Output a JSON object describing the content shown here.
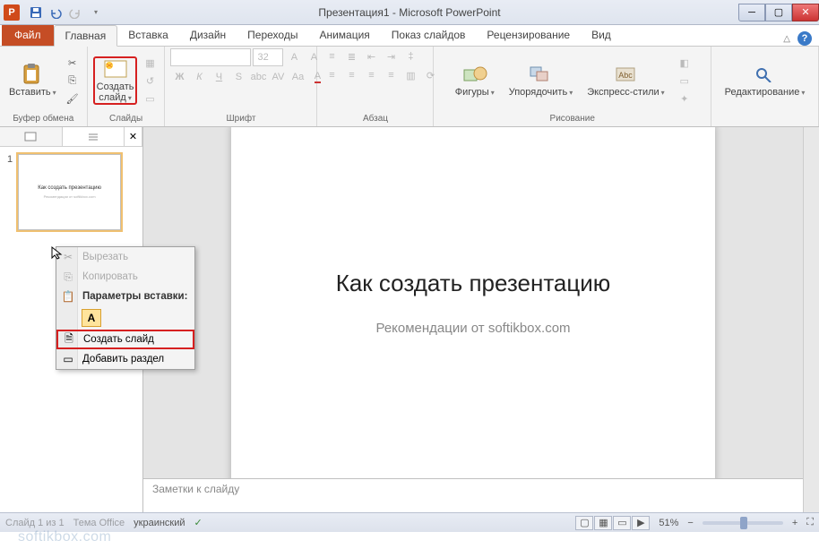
{
  "window": {
    "title": "Презентация1 - Microsoft PowerPoint",
    "app_letter": "P"
  },
  "tabs": {
    "file": "Файл",
    "items": [
      "Главная",
      "Вставка",
      "Дизайн",
      "Переходы",
      "Анимация",
      "Показ слайдов",
      "Рецензирование",
      "Вид"
    ],
    "active_index": 0
  },
  "ribbon": {
    "clipboard": {
      "paste": "Вставить",
      "group": "Буфер обмена"
    },
    "slides": {
      "new_slide": "Создать\nслайд",
      "group": "Слайды"
    },
    "font": {
      "size": "32",
      "group": "Шрифт"
    },
    "paragraph": {
      "group": "Абзац"
    },
    "drawing": {
      "shapes": "Фигуры",
      "arrange": "Упорядочить",
      "styles": "Экспресс-стили",
      "group": "Рисование"
    },
    "editing": {
      "label": "Редактирование"
    }
  },
  "panel": {
    "slide_number": "1",
    "thumb_title": "Как создать презентацию",
    "thumb_sub": "Рекомендации от softikbox.com"
  },
  "context_menu": {
    "cut": "Вырезать",
    "copy": "Копировать",
    "paste_options": "Параметры вставки:",
    "paste_letter": "A",
    "new_slide": "Создать слайд",
    "add_section": "Добавить раздел"
  },
  "slide": {
    "title": "Как создать презентацию",
    "subtitle": "Рекомендации от softikbox.com"
  },
  "notes": {
    "placeholder": "Заметки к слайду"
  },
  "status": {
    "slide_info": "Слайд 1 из 1",
    "theme": "Тема Office",
    "language": "украинский",
    "zoom": "51%"
  },
  "watermark": "softikbox.com"
}
